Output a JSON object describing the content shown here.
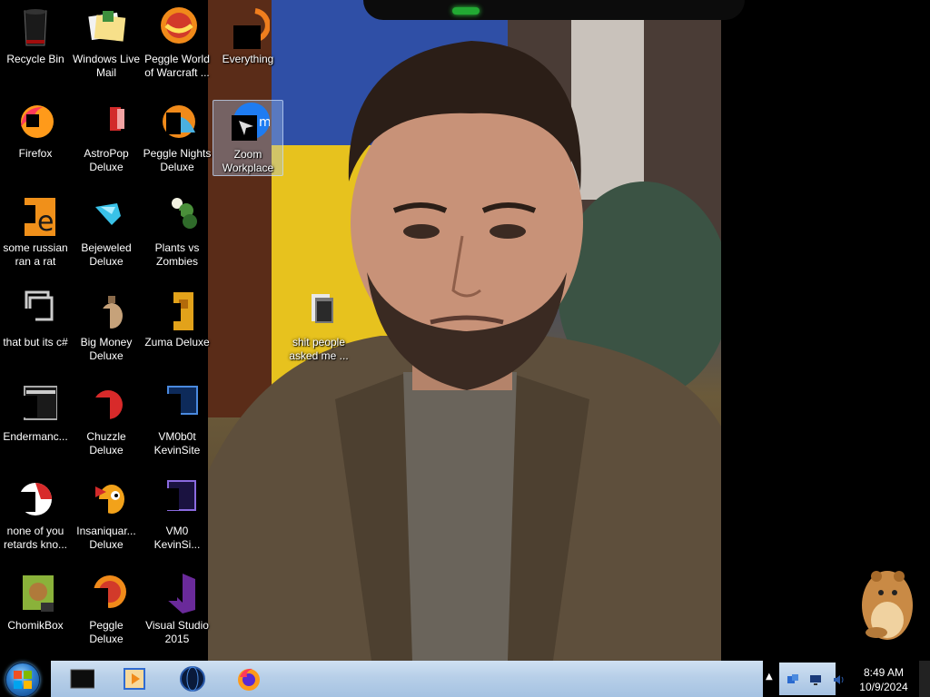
{
  "desktop": {
    "icons": [
      {
        "label": "Recycle Bin",
        "icon": "recycle-bin-icon"
      },
      {
        "label": "Windows Live Mail",
        "icon": "mail-icon"
      },
      {
        "label": "Peggle World of Warcraft ...",
        "icon": "peggle-icon"
      },
      {
        "label": "Everything",
        "icon": "search-app-icon"
      },
      {
        "label": "Firefox",
        "icon": "firefox-icon"
      },
      {
        "label": "AstroPop Deluxe",
        "icon": "astropop-icon"
      },
      {
        "label": "Peggle Nights Deluxe",
        "icon": "peggle-nights-icon"
      },
      {
        "label": "Zoom Workplace",
        "icon": "zoom-icon"
      },
      {
        "label": "some russian ran a rat",
        "icon": "program-icon"
      },
      {
        "label": "Bejeweled Deluxe",
        "icon": "bejeweled-icon"
      },
      {
        "label": "Plants vs Zombies",
        "icon": "plants-vs-zombies-icon"
      },
      {
        "label": "that but its c#",
        "icon": "shortcut-icon"
      },
      {
        "label": "Big Money Deluxe",
        "icon": "big-money-icon"
      },
      {
        "label": "Zuma Deluxe",
        "icon": "zuma-icon"
      },
      {
        "label": "shit people asked me ...",
        "icon": "folder-icon"
      },
      {
        "label": "Endermanc...",
        "icon": "app-window-icon"
      },
      {
        "label": "Chuzzle Deluxe",
        "icon": "chuzzle-icon"
      },
      {
        "label": "VM0b0t KevinSite",
        "icon": "vm-icon"
      },
      {
        "label": "none of you retards kno...",
        "icon": "app-icon"
      },
      {
        "label": "Insaniquar... Deluxe",
        "icon": "insaniquarium-icon"
      },
      {
        "label": "VM0 KevinSi...",
        "icon": "vm-icon"
      },
      {
        "label": "ChomikBox",
        "icon": "chomikbox-icon"
      },
      {
        "label": "Peggle Deluxe",
        "icon": "peggle-icon"
      },
      {
        "label": "Visual Studio 2015",
        "icon": "visual-studio-icon"
      }
    ]
  },
  "taskbar": {
    "start": "start-orb-icon",
    "pinned": [
      "black-window-app-icon",
      "media-player-icon",
      "globe-app-icon",
      "firefox-icon"
    ],
    "tray": {
      "overflow": "chevron-up-icon",
      "icons": [
        "network-icon",
        "monitor-icon",
        "speaker-icon"
      ],
      "time": "8:49 AM",
      "date": "10/9/2024"
    }
  }
}
